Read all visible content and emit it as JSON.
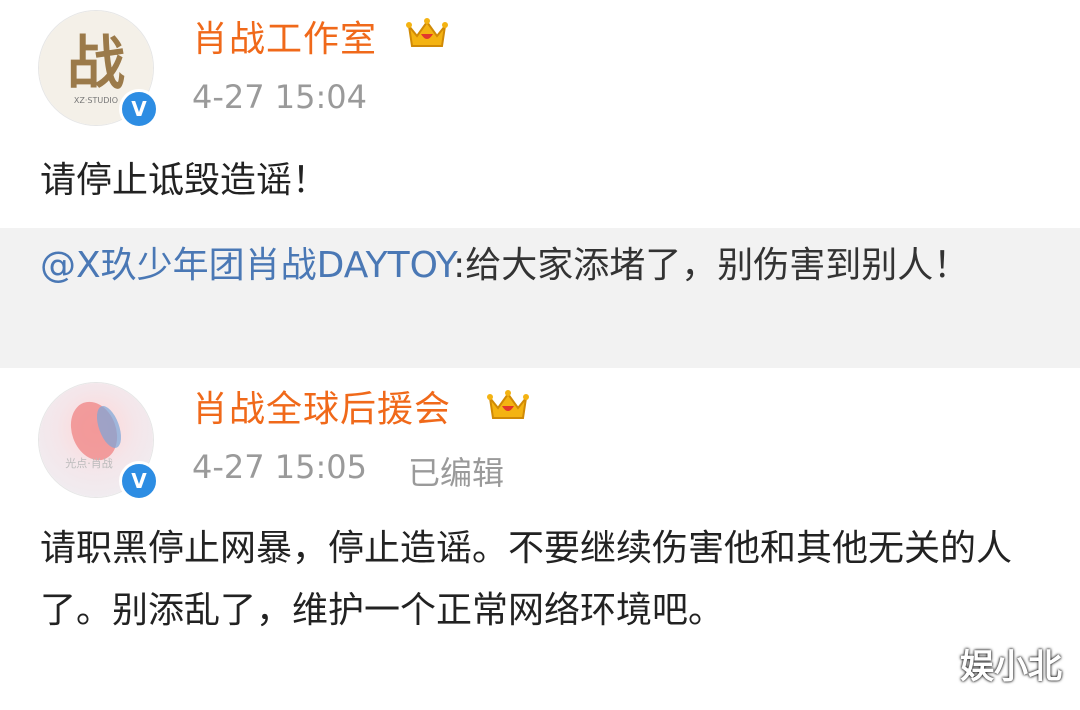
{
  "post1": {
    "author": "肖战工作室",
    "avatar_text": "战",
    "avatar_subtext": "XZ·STUDIO",
    "time": "4-27 15:04",
    "body": "请停止诋毁造谣！"
  },
  "quote": {
    "mention": "@X玖少年团肖战DAYTOY",
    "text": ":给大家添堵了，别伤害到别人！"
  },
  "post2": {
    "author": "肖战全球后援会",
    "avatar_text": "光点·肖战",
    "time": "4-27 15:05",
    "edited": "已编辑",
    "body": "请职黑停止网暴，停止造谣。不要继续伤害他和其他无关的人了。别添乱了，维护一个正常网络环境吧。"
  },
  "watermark": "娱小北",
  "colors": {
    "name": "#f0691a",
    "mention": "#4a78b5",
    "verified_badge": "#2d8de3",
    "quote_bg": "#f2f2f2"
  }
}
